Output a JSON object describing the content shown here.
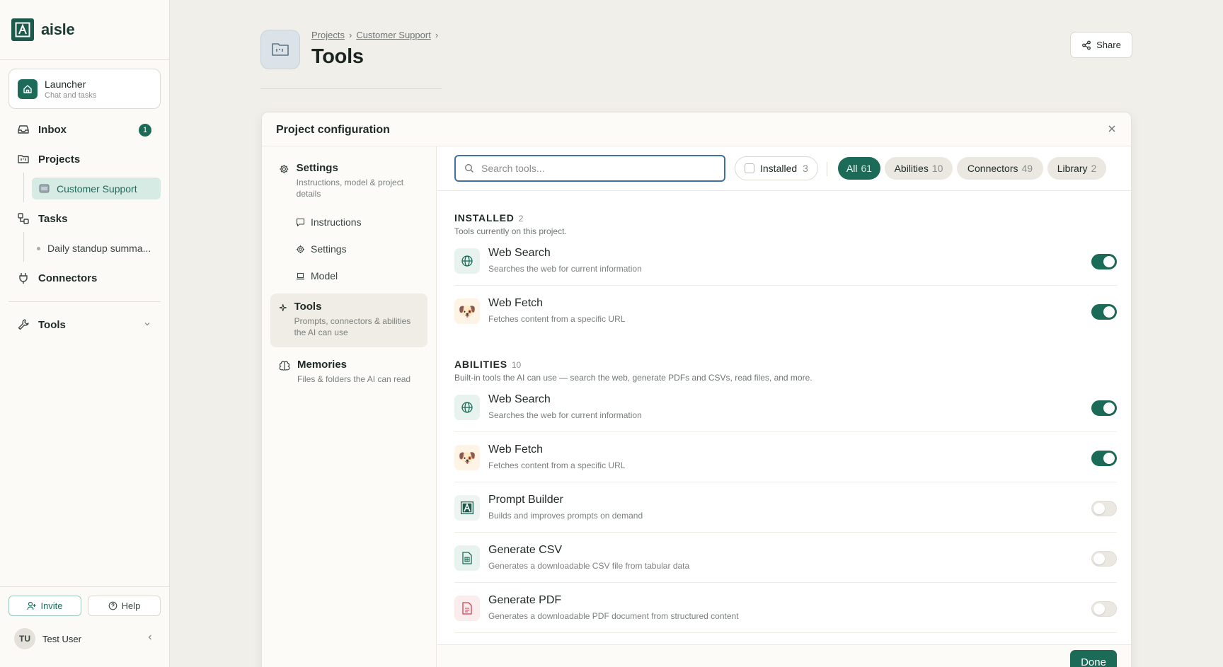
{
  "brand": {
    "name": "aisle"
  },
  "sidebar": {
    "launcher": {
      "title": "Launcher",
      "subtitle": "Chat and tasks"
    },
    "inbox": {
      "label": "Inbox",
      "badge": "1"
    },
    "projects": {
      "label": "Projects",
      "active_child": "Customer Support"
    },
    "tasks": {
      "label": "Tasks",
      "child": "Daily standup summa..."
    },
    "connectors": {
      "label": "Connectors"
    },
    "tools": {
      "label": "Tools"
    },
    "invite_label": "Invite",
    "help_label": "Help",
    "user": {
      "initials": "TU",
      "name": "Test User"
    }
  },
  "header": {
    "breadcrumb": [
      "Projects",
      "Customer Support"
    ],
    "title": "Tools",
    "share_label": "Share"
  },
  "modal": {
    "title": "Project configuration",
    "sections": {
      "settings": {
        "title": "Settings",
        "desc": "Instructions, model & project details"
      },
      "sub": [
        "Instructions",
        "Settings",
        "Model"
      ],
      "tools": {
        "title": "Tools",
        "desc": "Prompts, connectors & abilities the AI can use"
      },
      "memories": {
        "title": "Memories",
        "desc": "Files & folders the AI can read"
      }
    },
    "search_placeholder": "Search tools...",
    "installed_filter": {
      "label": "Installed",
      "count": "3"
    },
    "chips": [
      {
        "label": "All",
        "count": "61"
      },
      {
        "label": "Abilities",
        "count": "10"
      },
      {
        "label": "Connectors",
        "count": "49"
      },
      {
        "label": "Library",
        "count": "2"
      }
    ],
    "groups": {
      "installed": {
        "title": "INSTALLED",
        "count": "2",
        "desc": "Tools currently on this project."
      },
      "abilities": {
        "title": "ABILITIES",
        "count": "10",
        "desc": "Built-in tools the AI can use — search the web, generate PDFs and CSVs, read files, and more."
      }
    },
    "installed_tools": [
      {
        "name": "Web Search",
        "desc": "Searches the web for current information",
        "enabled": true
      },
      {
        "name": "Web Fetch",
        "desc": "Fetches content from a specific URL",
        "enabled": true
      }
    ],
    "ability_tools": [
      {
        "name": "Web Search",
        "desc": "Searches the web for current information",
        "enabled": true
      },
      {
        "name": "Web Fetch",
        "desc": "Fetches content from a specific URL",
        "enabled": true
      },
      {
        "name": "Prompt Builder",
        "desc": "Builds and improves prompts on demand",
        "enabled": false
      },
      {
        "name": "Generate CSV",
        "desc": "Generates a downloadable CSV file from tabular data",
        "enabled": false
      },
      {
        "name": "Generate PDF",
        "desc": "Generates a downloadable PDF document from structured content",
        "enabled": false
      }
    ],
    "done_label": "Done"
  },
  "icons": {
    "web_search": "globe-icon",
    "web_fetch": "dog-icon",
    "prompt_builder": "aisle-logo-icon",
    "generate_csv": "csv-file-icon",
    "generate_pdf": "pdf-file-icon"
  },
  "colors": {
    "accent": "#1c6b59",
    "search_focus": "#3f6fa3",
    "pdf": "#d2414f"
  }
}
